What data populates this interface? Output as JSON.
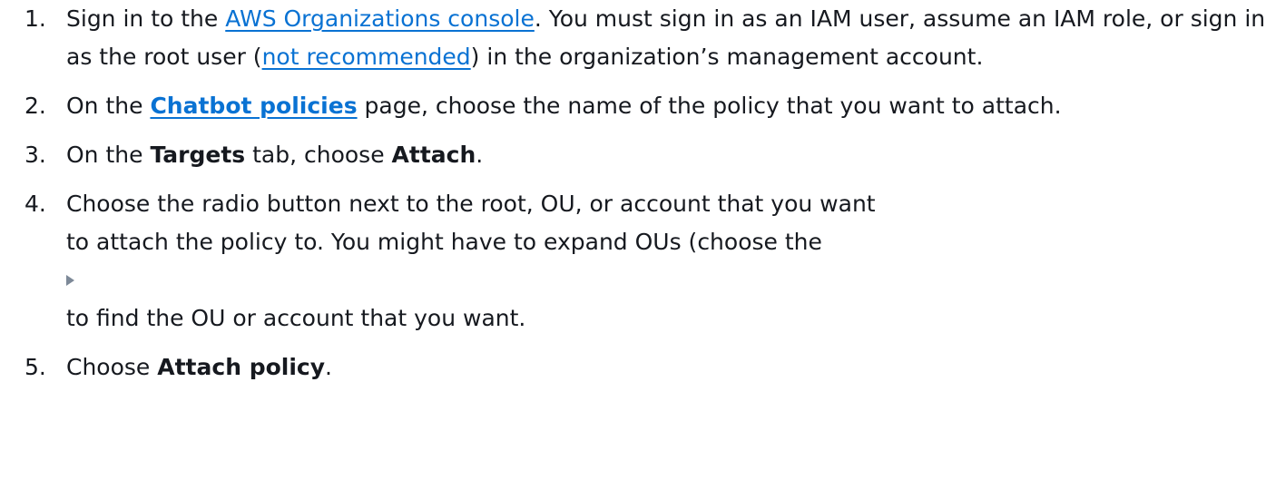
{
  "steps": [
    {
      "number": "1.",
      "text_before_link": "Sign in to the ",
      "link_text": "AWS Organizations console",
      "text_after_link": ". You must sign in as an IAM user, assume an IAM role, or sign in as the root user (",
      "link2_text": "not recommended",
      "text_after_link2": ") in the organization’s management account."
    },
    {
      "number": "2.",
      "text_before": "On the ",
      "link_text": "Chatbot policies",
      "text_after": " page, choose the name of the policy that you want to attach."
    },
    {
      "number": "3.",
      "text_before": "On the ",
      "bold1": "Targets",
      "text_middle": " tab, choose ",
      "bold2": "Attach",
      "text_after": "."
    },
    {
      "number": "4.",
      "line1": "Choose the radio button next to the root, OU, or account that you want",
      "line2": "to attach the policy to. You might have to expand OUs (choose the",
      "icon": "caret-right-icon",
      "line3": "to find the OU or account that you want."
    },
    {
      "number": "5.",
      "text_before": "Choose ",
      "bold": "Attach policy",
      "text_after": "."
    }
  ],
  "colors": {
    "text": "#16191f",
    "link": "#0972d3",
    "icon": "#7d8998"
  }
}
